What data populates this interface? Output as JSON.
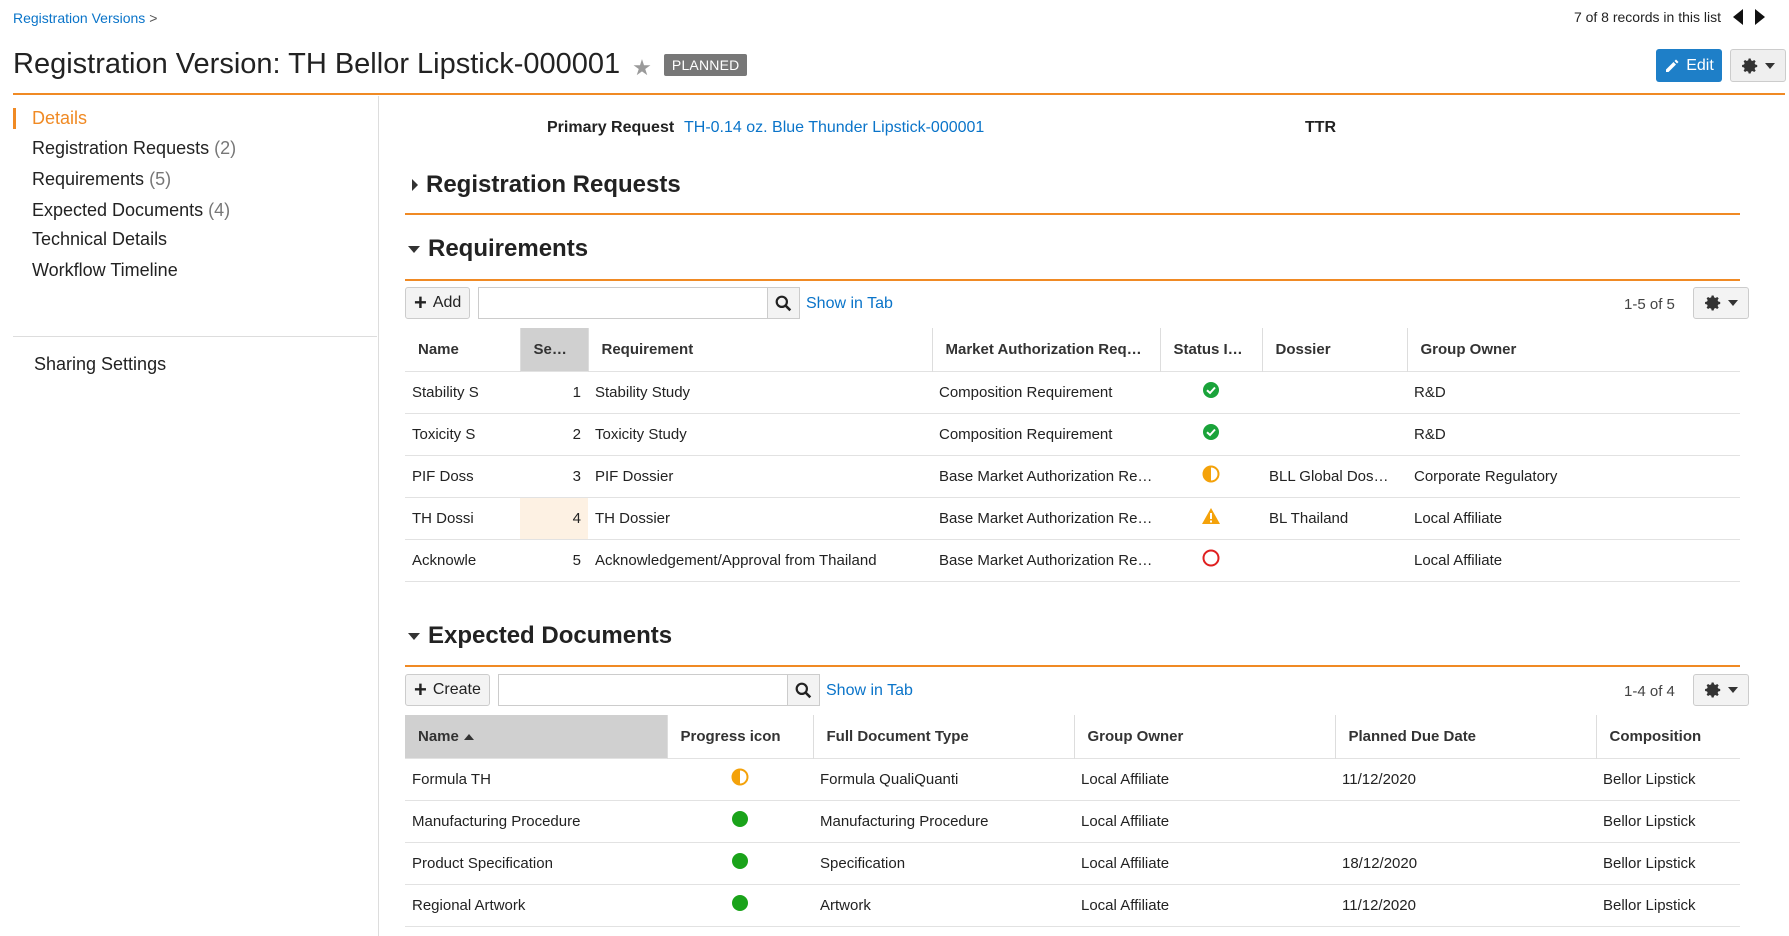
{
  "breadcrumb": {
    "link": "Registration Versions",
    "sep": ">"
  },
  "records": {
    "text": "7 of 8 records in this list"
  },
  "header": {
    "title": "Registration Version: TH Bellor Lipstick-000001",
    "status": "PLANNED",
    "edit_label": "Edit"
  },
  "sidebar": {
    "items": [
      {
        "label": "Details",
        "count": ""
      },
      {
        "label": "Registration Requests",
        "count": "(2)"
      },
      {
        "label": "Requirements",
        "count": "(5)"
      },
      {
        "label": "Expected Documents",
        "count": "(4)"
      },
      {
        "label": "Technical Details",
        "count": ""
      },
      {
        "label": "Workflow Timeline",
        "count": ""
      }
    ],
    "sharing": "Sharing Settings"
  },
  "details": {
    "primary_request_label": "Primary Request",
    "primary_request_value": "TH-0.14 oz. Blue Thunder Lipstick-000001",
    "ttr_label": "TTR"
  },
  "sections": {
    "registration_requests": "Registration Requests",
    "requirements": "Requirements",
    "expected_documents": "Expected Documents"
  },
  "requirements": {
    "add_label": "Add",
    "show_in_tab": "Show in Tab",
    "pager": "1-5 of 5",
    "columns": [
      "Name",
      "Se…",
      "Requirement",
      "Market Authorization Requi…",
      "Status I…",
      "Dossier",
      "Group Owner"
    ],
    "rows": [
      {
        "name": "Stability S",
        "seq": "1",
        "requirement": "Stability Study",
        "mar": "Composition Requirement",
        "status": "complete",
        "dossier": "",
        "owner": "R&D"
      },
      {
        "name": "Toxicity S",
        "seq": "2",
        "requirement": "Toxicity Study",
        "mar": "Composition Requirement",
        "status": "complete",
        "dossier": "",
        "owner": "R&D"
      },
      {
        "name": "PIF Doss",
        "seq": "3",
        "requirement": "PIF Dossier",
        "mar": "Base Market Authorization Re…",
        "status": "half",
        "dossier": "BLL Global Dos…",
        "owner": "Corporate Regulatory"
      },
      {
        "name": "TH Dossi",
        "seq": "4",
        "requirement": "TH Dossier",
        "mar": "Base Market Authorization Re…",
        "status": "warning",
        "dossier": "BL Thailand",
        "owner": "Local Affiliate"
      },
      {
        "name": "Acknowle",
        "seq": "5",
        "requirement": "Acknowledgement/Approval from Thailand",
        "mar": "Base Market Authorization Re…",
        "status": "open",
        "dossier": "",
        "owner": "Local Affiliate"
      }
    ]
  },
  "expected_documents": {
    "create_label": "Create",
    "show_in_tab": "Show in Tab",
    "pager": "1-4 of 4",
    "columns": [
      "Name",
      "Progress icon",
      "Full Document Type",
      "Group Owner",
      "Planned Due Date",
      "Composition"
    ],
    "rows": [
      {
        "name": "Formula TH",
        "progress": "half",
        "type": "Formula QualiQuanti",
        "owner": "Local Affiliate",
        "due": "11/12/2020",
        "composition": "Bellor Lipstick"
      },
      {
        "name": "Manufacturing Procedure",
        "progress": "full",
        "type": "Manufacturing Procedure",
        "owner": "Local Affiliate",
        "due": "",
        "composition": "Bellor Lipstick"
      },
      {
        "name": "Product Specification",
        "progress": "full",
        "type": "Specification",
        "owner": "Local Affiliate",
        "due": "18/12/2020",
        "composition": "Bellor Lipstick"
      },
      {
        "name": "Regional Artwork",
        "progress": "full",
        "type": "Artwork",
        "owner": "Local Affiliate",
        "due": "11/12/2020",
        "composition": "Bellor Lipstick"
      }
    ]
  },
  "colors": {
    "accent": "#f08a24",
    "link": "#0a74c9",
    "edit": "#1e7fc8",
    "ok": "#1aa33a",
    "warn": "#f4a20a",
    "error": "#e02020"
  }
}
